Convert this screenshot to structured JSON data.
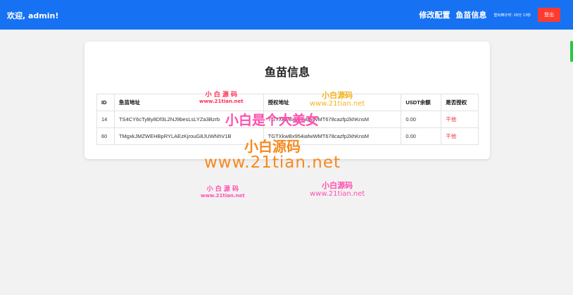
{
  "header": {
    "welcome": "欢迎, admin!",
    "nav": [
      "修改配置",
      "鱼苗信息"
    ],
    "countdown": "登出倒计时: 26分 13秒",
    "logout": "登出"
  },
  "card": {
    "title": "鱼苗信息",
    "columns": [
      "ID",
      "鱼苗地址",
      "授权地址",
      "USDT余额",
      "是否授权"
    ],
    "rows": [
      [
        "14",
        "TS4CY6cTyBy8Df3L2NJ9besLsLYZa3Bzrb",
        "TGTXkwBx954iafwWMT678cazfp2khKnsM",
        "0.00",
        "干他"
      ],
      [
        "60",
        "TMgxkJMZWEHBpRYLAEzKjrouG8JUWNhV1B",
        "TGTXkwBx954iafwWMT678cazfp2khKnsM",
        "0.00",
        "干他"
      ]
    ]
  },
  "watermarks": {
    "brand_cn": "小白源码",
    "brand_cn_spaced": "小 白 源 码",
    "brand_url": "www.21tian.net",
    "slogan": "小白是个大美女"
  },
  "colors": {
    "topbar": "#1672f3",
    "logout": "#ff3b30",
    "unauthorized_text": "#e8382f"
  }
}
